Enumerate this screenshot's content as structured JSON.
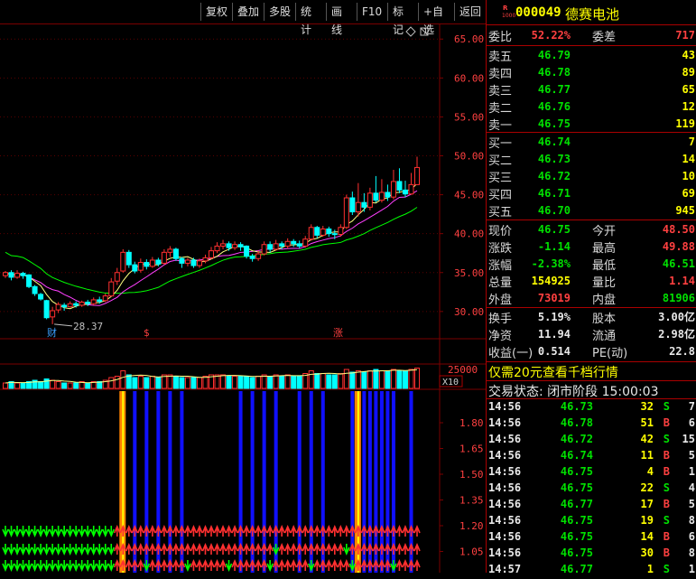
{
  "toolbar": {
    "buttons": [
      "复权",
      "叠加",
      "多股",
      "统计",
      "画线",
      "F10",
      "标记",
      "+自选",
      "返回"
    ]
  },
  "chart": {
    "price_axis": [
      "65.00",
      "60.00",
      "55.00",
      "50.00",
      "45.00",
      "40.00",
      "35.00",
      "30.00"
    ],
    "low_label": "28.37",
    "markers": [
      "财",
      "$",
      "涨"
    ],
    "volume_axis": "25000",
    "volume_unit": "X10",
    "indicator_axis": [
      "1.80",
      "1.65",
      "1.50",
      "1.35",
      "1.20",
      "1.05"
    ],
    "colors": {
      "up": "#ff3030",
      "down": "#00ffff",
      "ma5": "#ffff80",
      "ma10": "#ff40ff",
      "ma20": "#00ff00",
      "grid": "#7a0000"
    }
  },
  "chart_data": {
    "type": "candlestick",
    "ylim": [
      26.5,
      67
    ],
    "candles": [
      {
        "o": 34.6,
        "c": 35.0,
        "h": 35.2,
        "l": 34.3
      },
      {
        "o": 35.0,
        "c": 34.4,
        "h": 35.3,
        "l": 34.0
      },
      {
        "o": 34.4,
        "c": 34.9,
        "h": 35.3,
        "l": 34.2
      },
      {
        "o": 34.9,
        "c": 34.6,
        "h": 35.1,
        "l": 34.2
      },
      {
        "o": 34.7,
        "c": 33.2,
        "h": 34.8,
        "l": 33.0
      },
      {
        "o": 33.2,
        "c": 32.3,
        "h": 33.4,
        "l": 32.0
      },
      {
        "o": 32.2,
        "c": 31.6,
        "h": 32.4,
        "l": 31.4
      },
      {
        "o": 31.4,
        "c": 29.2,
        "h": 31.5,
        "l": 29.0
      },
      {
        "o": 29.3,
        "c": 30.1,
        "h": 30.6,
        "l": 28.37
      },
      {
        "o": 30.2,
        "c": 30.9,
        "h": 31.2,
        "l": 29.8
      },
      {
        "o": 30.8,
        "c": 30.6,
        "h": 31.1,
        "l": 30.1
      },
      {
        "o": 30.6,
        "c": 31.0,
        "h": 31.3,
        "l": 30.5
      },
      {
        "o": 31.0,
        "c": 30.8,
        "h": 31.3,
        "l": 30.5
      },
      {
        "o": 30.8,
        "c": 31.2,
        "h": 31.4,
        "l": 30.6
      },
      {
        "o": 31.2,
        "c": 31.0,
        "h": 31.5,
        "l": 30.7
      },
      {
        "o": 31.0,
        "c": 31.5,
        "h": 31.8,
        "l": 30.8
      },
      {
        "o": 31.5,
        "c": 31.3,
        "h": 31.9,
        "l": 31.0
      },
      {
        "o": 31.4,
        "c": 32.0,
        "h": 32.3,
        "l": 31.2
      },
      {
        "o": 32.0,
        "c": 33.8,
        "h": 34.3,
        "l": 31.9
      },
      {
        "o": 33.9,
        "c": 35.0,
        "h": 35.6,
        "l": 33.4
      },
      {
        "o": 35.2,
        "c": 37.6,
        "h": 38.0,
        "l": 35.0
      },
      {
        "o": 37.6,
        "c": 36.0,
        "h": 37.9,
        "l": 35.6
      },
      {
        "o": 36.0,
        "c": 35.2,
        "h": 36.4,
        "l": 34.9
      },
      {
        "o": 35.3,
        "c": 36.3,
        "h": 36.8,
        "l": 35.0
      },
      {
        "o": 36.3,
        "c": 35.8,
        "h": 36.7,
        "l": 35.4
      },
      {
        "o": 35.8,
        "c": 36.6,
        "h": 37.0,
        "l": 35.6
      },
      {
        "o": 36.6,
        "c": 36.1,
        "h": 36.9,
        "l": 35.8
      },
      {
        "o": 36.2,
        "c": 37.6,
        "h": 38.0,
        "l": 36.0
      },
      {
        "o": 37.6,
        "c": 38.0,
        "h": 38.4,
        "l": 37.0
      },
      {
        "o": 38.0,
        "c": 36.8,
        "h": 38.2,
        "l": 36.5
      },
      {
        "o": 36.8,
        "c": 36.2,
        "h": 37.0,
        "l": 35.6
      },
      {
        "o": 36.2,
        "c": 36.6,
        "h": 36.9,
        "l": 35.8
      },
      {
        "o": 36.6,
        "c": 35.9,
        "h": 36.9,
        "l": 35.6
      },
      {
        "o": 35.9,
        "c": 36.5,
        "h": 36.8,
        "l": 35.6
      },
      {
        "o": 36.5,
        "c": 36.9,
        "h": 37.3,
        "l": 36.2
      },
      {
        "o": 36.9,
        "c": 37.8,
        "h": 38.3,
        "l": 36.7
      },
      {
        "o": 37.8,
        "c": 38.4,
        "h": 38.9,
        "l": 37.5
      },
      {
        "o": 38.4,
        "c": 38.7,
        "h": 39.2,
        "l": 38.0
      },
      {
        "o": 38.7,
        "c": 38.2,
        "h": 39.0,
        "l": 37.8
      },
      {
        "o": 38.2,
        "c": 38.6,
        "h": 39.0,
        "l": 37.9
      },
      {
        "o": 38.6,
        "c": 38.3,
        "h": 38.9,
        "l": 37.8
      },
      {
        "o": 38.4,
        "c": 37.1,
        "h": 38.5,
        "l": 36.8
      },
      {
        "o": 37.1,
        "c": 36.8,
        "h": 37.4,
        "l": 36.4
      },
      {
        "o": 36.8,
        "c": 37.4,
        "h": 37.8,
        "l": 36.5
      },
      {
        "o": 37.4,
        "c": 38.6,
        "h": 39.0,
        "l": 37.2
      },
      {
        "o": 38.6,
        "c": 38.0,
        "h": 39.0,
        "l": 37.6
      },
      {
        "o": 38.0,
        "c": 38.7,
        "h": 39.2,
        "l": 37.8
      },
      {
        "o": 38.7,
        "c": 38.4,
        "h": 39.0,
        "l": 38.0
      },
      {
        "o": 38.4,
        "c": 39.0,
        "h": 39.4,
        "l": 38.1
      },
      {
        "o": 39.0,
        "c": 38.7,
        "h": 39.3,
        "l": 38.3
      },
      {
        "o": 38.7,
        "c": 38.4,
        "h": 39.1,
        "l": 38.1
      },
      {
        "o": 38.4,
        "c": 39.3,
        "h": 39.7,
        "l": 38.2
      },
      {
        "o": 39.3,
        "c": 40.8,
        "h": 41.2,
        "l": 39.1
      },
      {
        "o": 40.8,
        "c": 39.8,
        "h": 41.0,
        "l": 39.4
      },
      {
        "o": 39.8,
        "c": 40.6,
        "h": 41.0,
        "l": 39.6
      },
      {
        "o": 40.6,
        "c": 40.0,
        "h": 40.9,
        "l": 39.6
      },
      {
        "o": 40.0,
        "c": 39.9,
        "h": 40.5,
        "l": 39.3
      },
      {
        "o": 39.9,
        "c": 40.8,
        "h": 41.2,
        "l": 39.6
      },
      {
        "o": 40.8,
        "c": 44.6,
        "h": 45.0,
        "l": 40.6
      },
      {
        "o": 44.6,
        "c": 42.8,
        "h": 45.4,
        "l": 42.4
      },
      {
        "o": 42.8,
        "c": 44.0,
        "h": 46.5,
        "l": 42.2
      },
      {
        "o": 44.0,
        "c": 43.4,
        "h": 45.2,
        "l": 42.8
      },
      {
        "o": 43.4,
        "c": 45.2,
        "h": 45.9,
        "l": 43.0
      },
      {
        "o": 45.2,
        "c": 44.3,
        "h": 47.4,
        "l": 44.0
      },
      {
        "o": 44.3,
        "c": 45.3,
        "h": 47.0,
        "l": 44.0
      },
      {
        "o": 45.3,
        "c": 44.7,
        "h": 46.3,
        "l": 44.2
      },
      {
        "o": 44.7,
        "c": 46.7,
        "h": 48.2,
        "l": 44.4
      },
      {
        "o": 46.7,
        "c": 45.6,
        "h": 48.4,
        "l": 45.2
      },
      {
        "o": 45.6,
        "c": 45.1,
        "h": 46.8,
        "l": 44.7
      },
      {
        "o": 45.1,
        "c": 46.3,
        "h": 47.8,
        "l": 45.0
      },
      {
        "o": 46.3,
        "c": 48.5,
        "h": 49.88,
        "l": 46.51
      }
    ],
    "volume": [
      4,
      5,
      4,
      4,
      5,
      6,
      5,
      7,
      6,
      5,
      4,
      4,
      4,
      5,
      4,
      5,
      5,
      6,
      8,
      9,
      13,
      10,
      8,
      9,
      8,
      9,
      8,
      10,
      10,
      9,
      8,
      8,
      8,
      8,
      9,
      10,
      10,
      10,
      9,
      9,
      9,
      9,
      8,
      9,
      10,
      9,
      10,
      9,
      10,
      9,
      9,
      11,
      13,
      11,
      11,
      10,
      10,
      11,
      14,
      12,
      13,
      12,
      13,
      14,
      13,
      13,
      14,
      13,
      13,
      14,
      15
    ]
  },
  "panel": {
    "header": {
      "code": "000049",
      "name": "德赛电池",
      "badge_top": "R",
      "badge_bottom": "1000"
    },
    "weibi": {
      "label": "委比",
      "value": "52.22%",
      "label2": "委差",
      "value2": "717"
    },
    "sells": [
      {
        "label": "卖五",
        "price": "46.79",
        "vol": "43"
      },
      {
        "label": "卖四",
        "price": "46.78",
        "vol": "89"
      },
      {
        "label": "卖三",
        "price": "46.77",
        "vol": "65"
      },
      {
        "label": "卖二",
        "price": "46.76",
        "vol": "12"
      },
      {
        "label": "卖一",
        "price": "46.75",
        "vol": "119"
      }
    ],
    "buys": [
      {
        "label": "买一",
        "price": "46.74",
        "vol": "7"
      },
      {
        "label": "买二",
        "price": "46.73",
        "vol": "14"
      },
      {
        "label": "买三",
        "price": "46.72",
        "vol": "10"
      },
      {
        "label": "买四",
        "price": "46.71",
        "vol": "69"
      },
      {
        "label": "买五",
        "price": "46.70",
        "vol": "945"
      }
    ],
    "quote": [
      {
        "l1": "现价",
        "v1": "46.75",
        "c1": "green",
        "l2": "今开",
        "v2": "48.50",
        "c2": "red"
      },
      {
        "l1": "涨跌",
        "v1": "-1.14",
        "c1": "green",
        "l2": "最高",
        "v2": "49.88",
        "c2": "red"
      },
      {
        "l1": "涨幅",
        "v1": "-2.38%",
        "c1": "green",
        "l2": "最低",
        "v2": "46.51",
        "c2": "green"
      },
      {
        "l1": "总量",
        "v1": "154925",
        "c1": "yellow",
        "l2": "量比",
        "v2": "1.14",
        "c2": "red"
      },
      {
        "l1": "外盘",
        "v1": "73019",
        "c1": "red",
        "l2": "内盘",
        "v2": "81906",
        "c2": "green"
      }
    ],
    "fund": [
      {
        "l1": "换手",
        "v1": "5.19%",
        "l2": "股本",
        "v2": "3.00亿"
      },
      {
        "l1": "净资",
        "v1": "11.94",
        "l2": "流通",
        "v2": "2.98亿"
      },
      {
        "l1": "收益(一)",
        "v1": "0.514",
        "l2": "PE(动)",
        "v2": "22.8"
      }
    ],
    "promo": "仅需20元查看千档行情",
    "trade_status": "交易状态: 闭市阶段 15:00:03",
    "ticks": [
      {
        "t": "14:56",
        "p": "46.73",
        "v": "32",
        "s": "S",
        "n": "7"
      },
      {
        "t": "14:56",
        "p": "46.78",
        "v": "51",
        "s": "B",
        "n": "6"
      },
      {
        "t": "14:56",
        "p": "46.72",
        "v": "42",
        "s": "S",
        "n": "15"
      },
      {
        "t": "14:56",
        "p": "46.74",
        "v": "11",
        "s": "B",
        "n": "5"
      },
      {
        "t": "14:56",
        "p": "46.75",
        "v": "4",
        "s": "B",
        "n": "1"
      },
      {
        "t": "14:56",
        "p": "46.75",
        "v": "22",
        "s": "S",
        "n": "4"
      },
      {
        "t": "14:56",
        "p": "46.77",
        "v": "17",
        "s": "B",
        "n": "5"
      },
      {
        "t": "14:56",
        "p": "46.75",
        "v": "19",
        "s": "S",
        "n": "8"
      },
      {
        "t": "14:56",
        "p": "46.75",
        "v": "14",
        "s": "B",
        "n": "6"
      },
      {
        "t": "14:56",
        "p": "46.75",
        "v": "30",
        "s": "B",
        "n": "8"
      },
      {
        "t": "14:57",
        "p": "46.77",
        "v": "1",
        "s": "S",
        "n": "1"
      }
    ]
  }
}
